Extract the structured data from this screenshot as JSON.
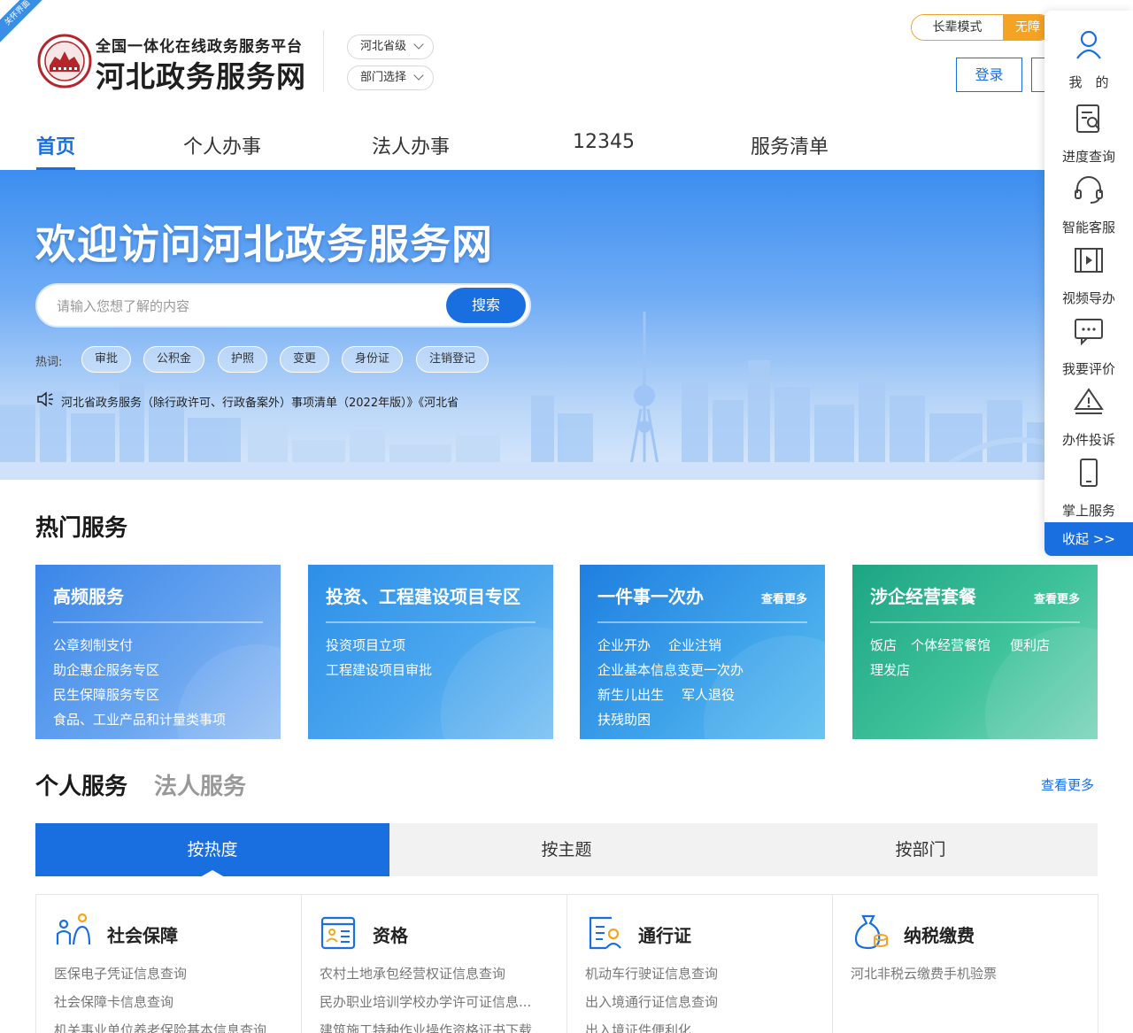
{
  "corner_ribbon": "关怀界面",
  "header": {
    "subtitle": "全国一体化在线政务服务平台",
    "title": "河北政务服务网",
    "region_select": "河北省级",
    "dept_select": "部门选择",
    "mode_elder": "长辈模式",
    "mode_access": "无障",
    "login": "登录"
  },
  "nav": [
    "首页",
    "个人办事",
    "法人办事",
    "12345",
    "服务清单"
  ],
  "hero": {
    "title": "欢迎访问河北政务服务网",
    "search_placeholder": "请输入您想了解的内容",
    "search_button": "搜索",
    "hot_label": "热词:",
    "hot_words": [
      "审批",
      "公积金",
      "护照",
      "变更",
      "身份证",
      "注销登记"
    ],
    "notice": "河北省政务服务（除行政许可、行政备案外）事项清单（2022年版）》《河北省"
  },
  "float_bar": {
    "items": [
      "我　的",
      "进度查询",
      "智能客服",
      "视频导办",
      "我要评价",
      "办件投诉",
      "掌上服务"
    ],
    "collapse": "收起 >>"
  },
  "hot_services": {
    "title": "热门服务",
    "cards": [
      {
        "title": "高频服务",
        "more": "",
        "links": [
          "公章刻制支付",
          "助企惠企服务专区",
          "民生保障服务专区",
          "食品、工业产品和计量类事项"
        ]
      },
      {
        "title": "投资、工程建设项目专区",
        "more": "",
        "links": [
          "投资项目立项",
          "工程建设项目审批"
        ]
      },
      {
        "title": "一件事一次办",
        "more": "查看更多",
        "links": [
          "企业开办",
          "企业注销",
          "企业基本信息变更一次办",
          "新生儿出生",
          "军人退役",
          "扶残助困"
        ]
      },
      {
        "title": "涉企经营套餐",
        "more": "查看更多",
        "links": [
          "饭店",
          "个体经营餐馆",
          "便利店",
          "理发店"
        ]
      }
    ]
  },
  "services": {
    "tab_personal": "个人服务",
    "tab_legal": "法人服务",
    "more": "查看更多",
    "segments": [
      "按热度",
      "按主题",
      "按部门"
    ],
    "categories": [
      {
        "title": "社会保障",
        "icon": "people-icon",
        "links": [
          "医保电子凭证信息查询",
          "社会保障卡信息查询",
          "机关事业单位养老保险基本信息查询"
        ]
      },
      {
        "title": "资格",
        "icon": "certificate-icon",
        "links": [
          "农村土地承包经营权证信息查询",
          "民办职业培训学校办学许可证信息...",
          "建筑施工特种作业操作资格证书下载"
        ]
      },
      {
        "title": "通行证",
        "icon": "pass-icon",
        "links": [
          "机动车行驶证信息查询",
          "出入境通行证信息查询",
          "出入境证件便利化"
        ]
      },
      {
        "title": "纳税缴费",
        "icon": "tax-icon",
        "links": [
          "河北非税云缴费手机验票"
        ]
      }
    ]
  },
  "colors": {
    "primary": "#1a6fe0",
    "accent_orange": "#f5a323"
  }
}
